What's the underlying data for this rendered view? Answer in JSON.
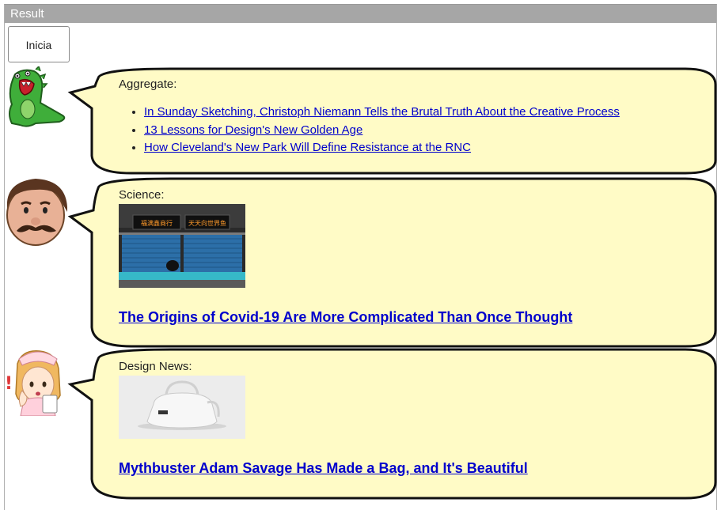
{
  "window": {
    "title": "Result"
  },
  "toolbar": {
    "start_label": "Inicia"
  },
  "feed": {
    "aggregate": {
      "label": "Aggregate:",
      "links": [
        "In Sunday Sketching, Christoph Niemann Tells the Brutal Truth About the Creative Process",
        "13 Lessons for Design's New Golden Age",
        "How Cleveland's New Park Will Define Resistance at the RNC"
      ]
    },
    "science": {
      "label": "Science:",
      "headline": "The Origins of Covid-19 Are More Complicated Than Once Thought",
      "image_signs": [
        "福满鑫商行",
        "天天向世界鱼"
      ]
    },
    "design": {
      "label": "Design News:",
      "headline": "Mythbuster Adam Savage Has Made a Bag, and It's Beautiful"
    }
  },
  "colors": {
    "bubble_fill": "#fffbc6",
    "bubble_stroke": "#111111",
    "link": "#0000cc",
    "titlebar": "#a6a6a6"
  }
}
